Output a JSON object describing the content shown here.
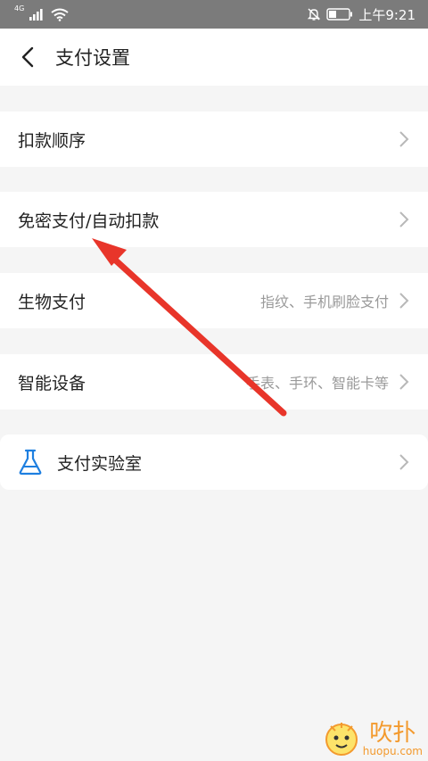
{
  "status_bar": {
    "network": "4G",
    "time": "上午9:21"
  },
  "header": {
    "title": "支付设置"
  },
  "rows": [
    {
      "label": "扣款顺序",
      "value": ""
    },
    {
      "label": "免密支付/自动扣款",
      "value": ""
    },
    {
      "label": "生物支付",
      "value": "指纹、手机刷脸支付"
    },
    {
      "label": "智能设备",
      "value": "手表、手环、智能卡等"
    },
    {
      "label": "支付实验室",
      "value": ""
    }
  ],
  "colors": {
    "status_bar_bg": "#7b7b7b",
    "page_bg": "#f5f5f5",
    "accent_blue": "#1e7fe0",
    "annotation_red": "#e8352a",
    "watermark_orange": "#f39a2e"
  },
  "watermark": {
    "text": "吹扑",
    "url": "huopu.com"
  }
}
